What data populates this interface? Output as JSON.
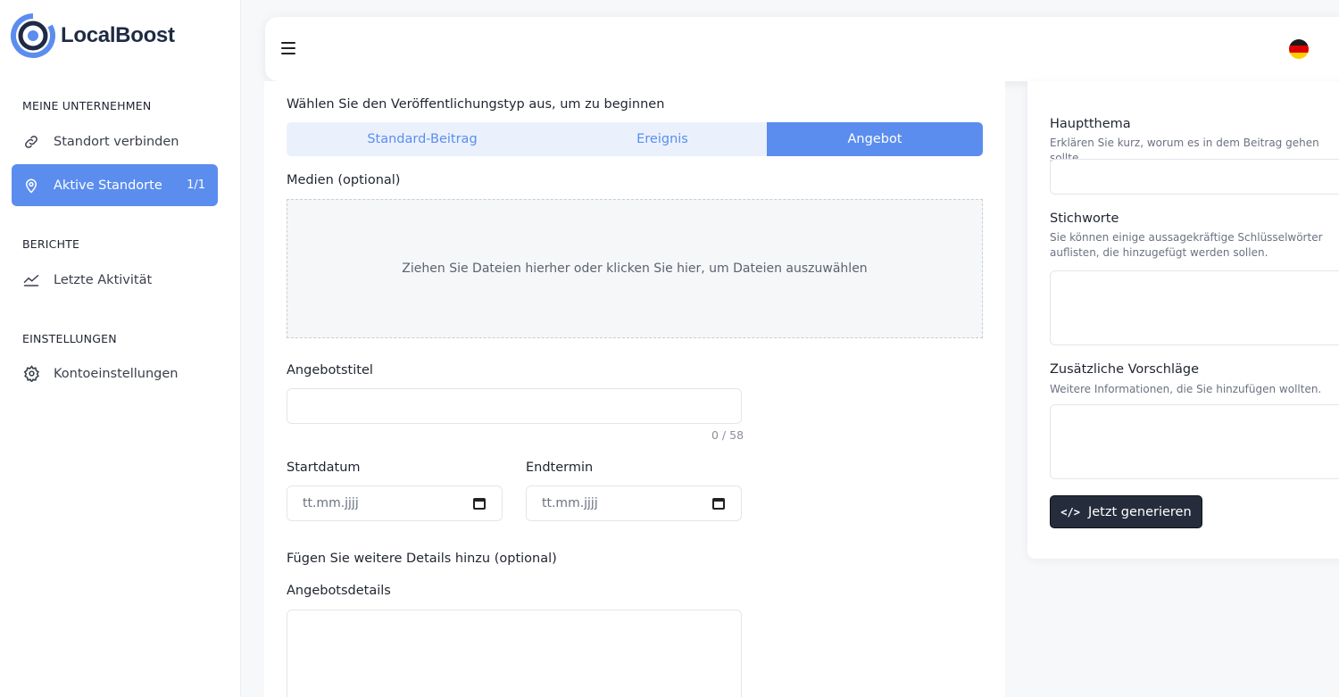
{
  "app": {
    "name": "LocalBoost",
    "brand_color": "#5b8def",
    "dark_button_color": "#252d3d"
  },
  "sidebar": {
    "sections": [
      {
        "title": "MEINE UNTERNEHMEN",
        "items": [
          {
            "label": "Standort verbinden",
            "icon": "link-icon"
          },
          {
            "label": "Aktive Standorte",
            "icon": "location-pin-icon",
            "count": "1/1",
            "active": true
          }
        ]
      },
      {
        "title": "BERICHTE",
        "items": [
          {
            "label": "Letzte Aktivität",
            "icon": "chart-line-icon"
          }
        ]
      },
      {
        "title": "EINSTELLUNGEN",
        "items": [
          {
            "label": "Kontoeinstellungen",
            "icon": "gear-icon"
          }
        ]
      }
    ]
  },
  "topbar": {
    "menu_icon": "hamburger-icon",
    "language_icon": "german-flag-icon"
  },
  "form": {
    "type_prompt": "Wählen Sie den Veröffentlichungstyp aus, um zu beginnen",
    "types": [
      "Standard-Beitrag",
      "Ereignis",
      "Angebot"
    ],
    "selected_type": "Angebot",
    "media_label": "Medien (optional)",
    "dropzone_text": "Ziehen Sie Dateien hierher oder klicken Sie hier, um Dateien auszuwählen",
    "offer_title_label": "Angebotstitel",
    "offer_title_value": "",
    "offer_title_counter": "0 / 58",
    "start_date_label": "Startdatum",
    "start_date_placeholder": "tt.mm.jjjj",
    "end_date_label": "Endtermin",
    "end_date_placeholder": "tt.mm.jjjj",
    "more_details_label": "Fügen Sie weitere Details hinzu (optional)",
    "offer_details_label": "Angebotsdetails",
    "offer_details_value": ""
  },
  "generator": {
    "main_topic_label": "Hauptthema",
    "main_topic_hint": "Erklären Sie kurz, worum es in dem Beitrag gehen sollte.",
    "main_topic_value": "",
    "keywords_label": "Stichworte",
    "keywords_hint": "Sie können einige aussagekräftige Schlüsselwörter auflisten, die hinzugefügt werden sollen.",
    "keywords_value": "",
    "suggestions_label": "Zusätzliche Vorschläge",
    "suggestions_hint": "Weitere Informationen, die Sie hinzufügen wollten.",
    "suggestions_value": "",
    "generate_button": "Jetzt generieren",
    "generate_icon": "code-icon"
  }
}
